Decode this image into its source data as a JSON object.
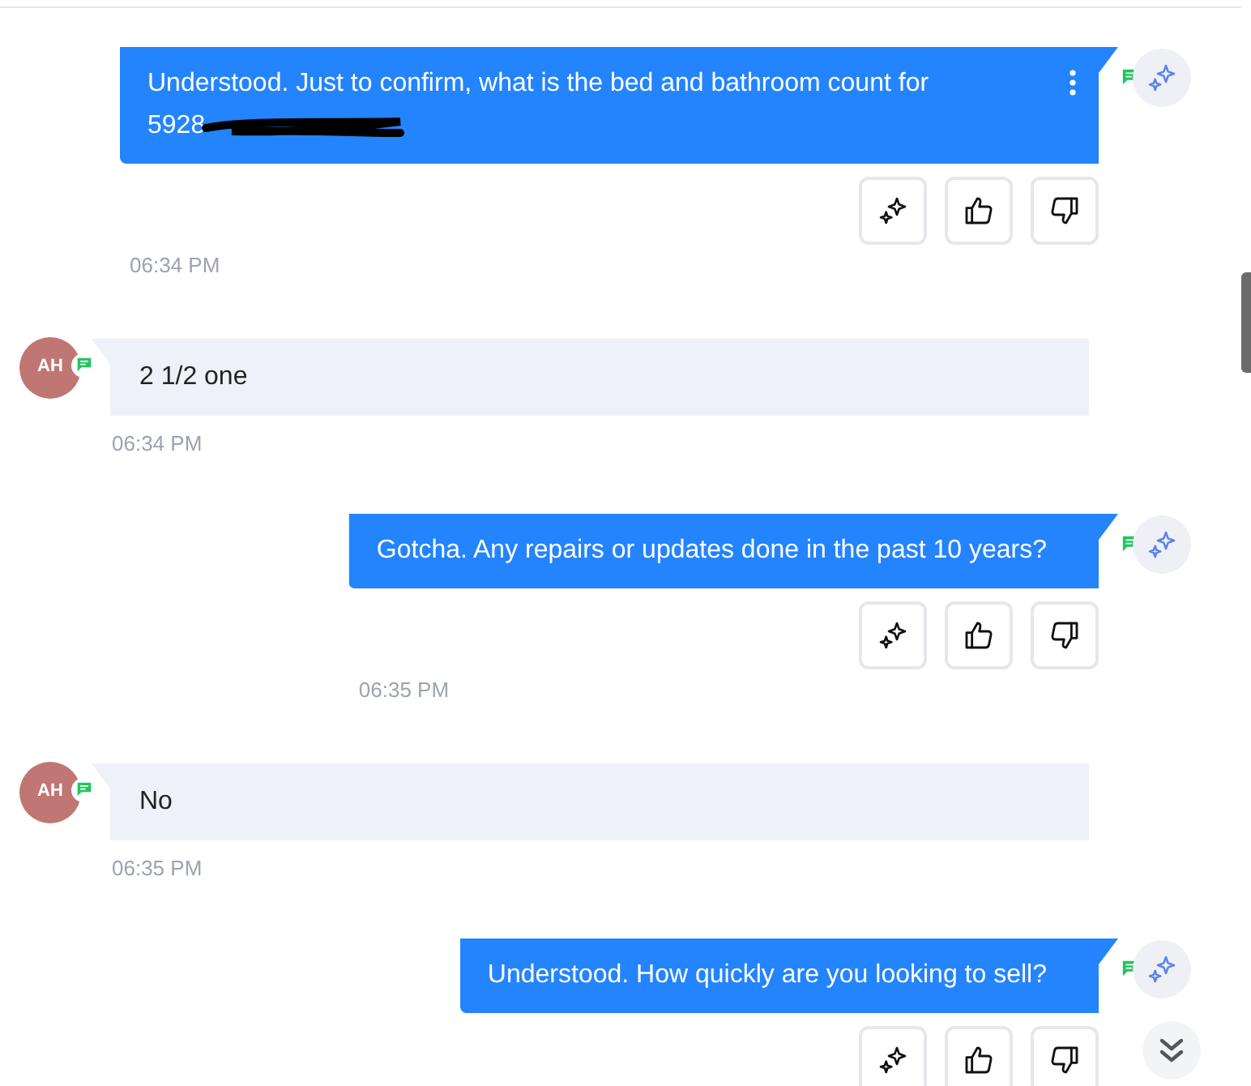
{
  "messages": [
    {
      "kind": "outgoing",
      "text": "Understood. Just to confirm, what is the bed and bathroom count for",
      "tail_text": "5928",
      "redacted": true,
      "menu": true,
      "time": "06:34 PM"
    },
    {
      "kind": "incoming",
      "avatar": "AH",
      "text": "2 1/2 one",
      "time": "06:34 PM"
    },
    {
      "kind": "outgoing",
      "text": "Gotcha. Any repairs or updates done in the past 10 years?",
      "menu": false,
      "time": "06:35 PM"
    },
    {
      "kind": "incoming",
      "avatar": "AH",
      "text": "No",
      "time": "06:35 PM"
    },
    {
      "kind": "outgoing",
      "text": "Understood. How quickly are you looking to sell?",
      "menu": false
    }
  ]
}
